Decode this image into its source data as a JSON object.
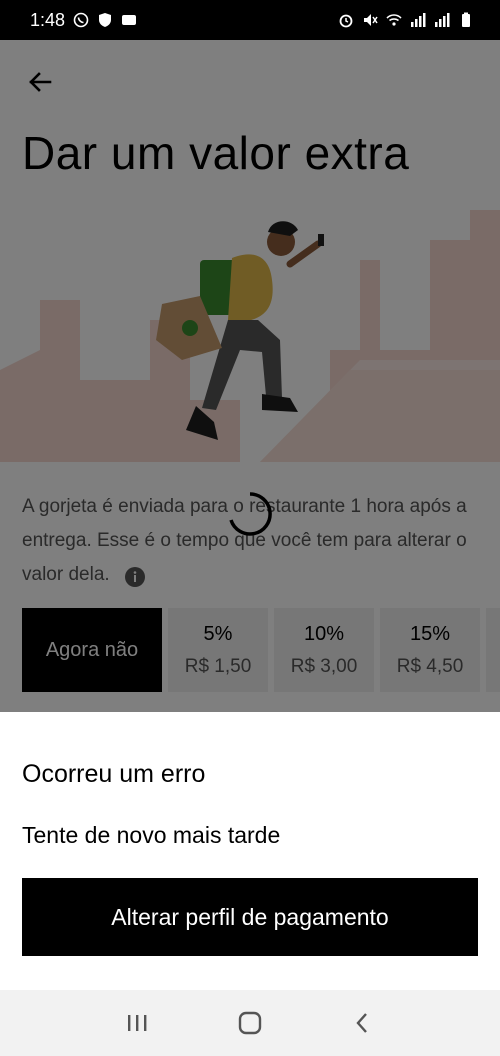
{
  "status_bar": {
    "time": "1:48",
    "left_icons": [
      "whatsapp-icon",
      "shield-icon",
      "notification-icon"
    ],
    "right_icons": [
      "alarm-icon",
      "mute-icon",
      "wifi-icon",
      "signal-icon",
      "signal-icon",
      "battery-icon"
    ]
  },
  "header": {
    "back_icon": "arrow-left-icon",
    "title": "Dar um valor extra"
  },
  "description": {
    "text": "A gorjeta é enviada para o restaurante 1 hora após a entrega. Esse é o tempo que você tem para alterar o valor dela.",
    "info_icon": "info-icon"
  },
  "tip_options": [
    {
      "label": "Agora não",
      "selected": true
    },
    {
      "percent": "5%",
      "amount": "R$ 1,50"
    },
    {
      "percent": "10%",
      "amount": "R$ 3,00"
    },
    {
      "percent": "15%",
      "amount": "R$ 4,50"
    }
  ],
  "error_sheet": {
    "title": "Ocorreu um erro",
    "message": "Tente de novo mais tarde",
    "button_label": "Alterar perfil de pagamento"
  },
  "nav_bar": {
    "icons": [
      "recent-apps-icon",
      "home-icon",
      "back-icon"
    ]
  },
  "colors": {
    "accent": "#000000",
    "tip_bg": "#eeeeee",
    "illustration_bg": "#f4d7cf"
  }
}
